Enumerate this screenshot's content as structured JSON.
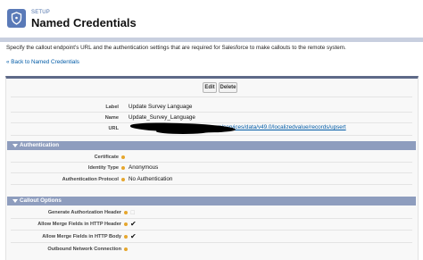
{
  "header": {
    "setup_label": "SETUP",
    "title": "Named Credentials",
    "icon": "shield-lock-icon"
  },
  "description": "Specify the callout endpoint's URL and the authentication settings that are required for Salesforce to make callouts to the remote system.",
  "back_link": "« Back to Named Credentials",
  "buttons": {
    "edit": "Edit",
    "delete": "Delete"
  },
  "detail": {
    "label": {
      "label": "Label",
      "value": "Update Survey Language"
    },
    "name": {
      "label": "Name",
      "value": "Update_Survey_Language"
    },
    "url": {
      "label": "URL",
      "value": "salesforce.com/services/data/v49.0/localizedvalue/records/upsert"
    }
  },
  "authentication": {
    "title": "Authentication",
    "certificate": {
      "label": "Certificate",
      "value": ""
    },
    "identity_type": {
      "label": "Identity Type",
      "value": "Anonymous"
    },
    "auth_protocol": {
      "label": "Authentication Protocol",
      "value": "No Authentication"
    }
  },
  "callout_options": {
    "title": "Callout Options",
    "generate_auth_header": {
      "label": "Generate Authorization Header",
      "checked": false
    },
    "merge_fields_header": {
      "label": "Allow Merge Fields in HTTP Header",
      "checked": true
    },
    "merge_fields_body": {
      "label": "Allow Merge Fields in HTTP Body",
      "checked": true
    },
    "outbound_network": {
      "label": "Outbound Network Connection",
      "value": ""
    }
  },
  "colors": {
    "section_bar": "#8e9dbe",
    "panel_top": "#5e6a88",
    "link": "#015ba7",
    "header_icon": "#5a7ab8",
    "info_icon": "#e6a62d"
  },
  "glyphs": {
    "check": "✔"
  }
}
